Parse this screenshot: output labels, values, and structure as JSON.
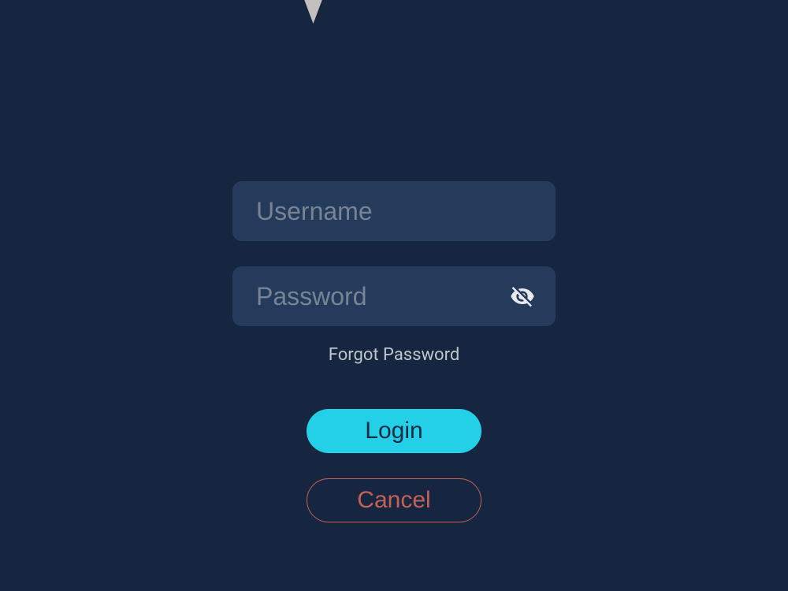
{
  "form": {
    "username_placeholder": "Username",
    "username_value": "",
    "password_placeholder": "Password",
    "password_value": "",
    "forgot_password_label": "Forgot Password",
    "login_button_label": "Login",
    "cancel_button_label": "Cancel"
  },
  "colors": {
    "background": "#172640",
    "input_background": "#253b5c",
    "accent": "#24d0e7",
    "danger": "#c56056",
    "placeholder": "#778494"
  }
}
